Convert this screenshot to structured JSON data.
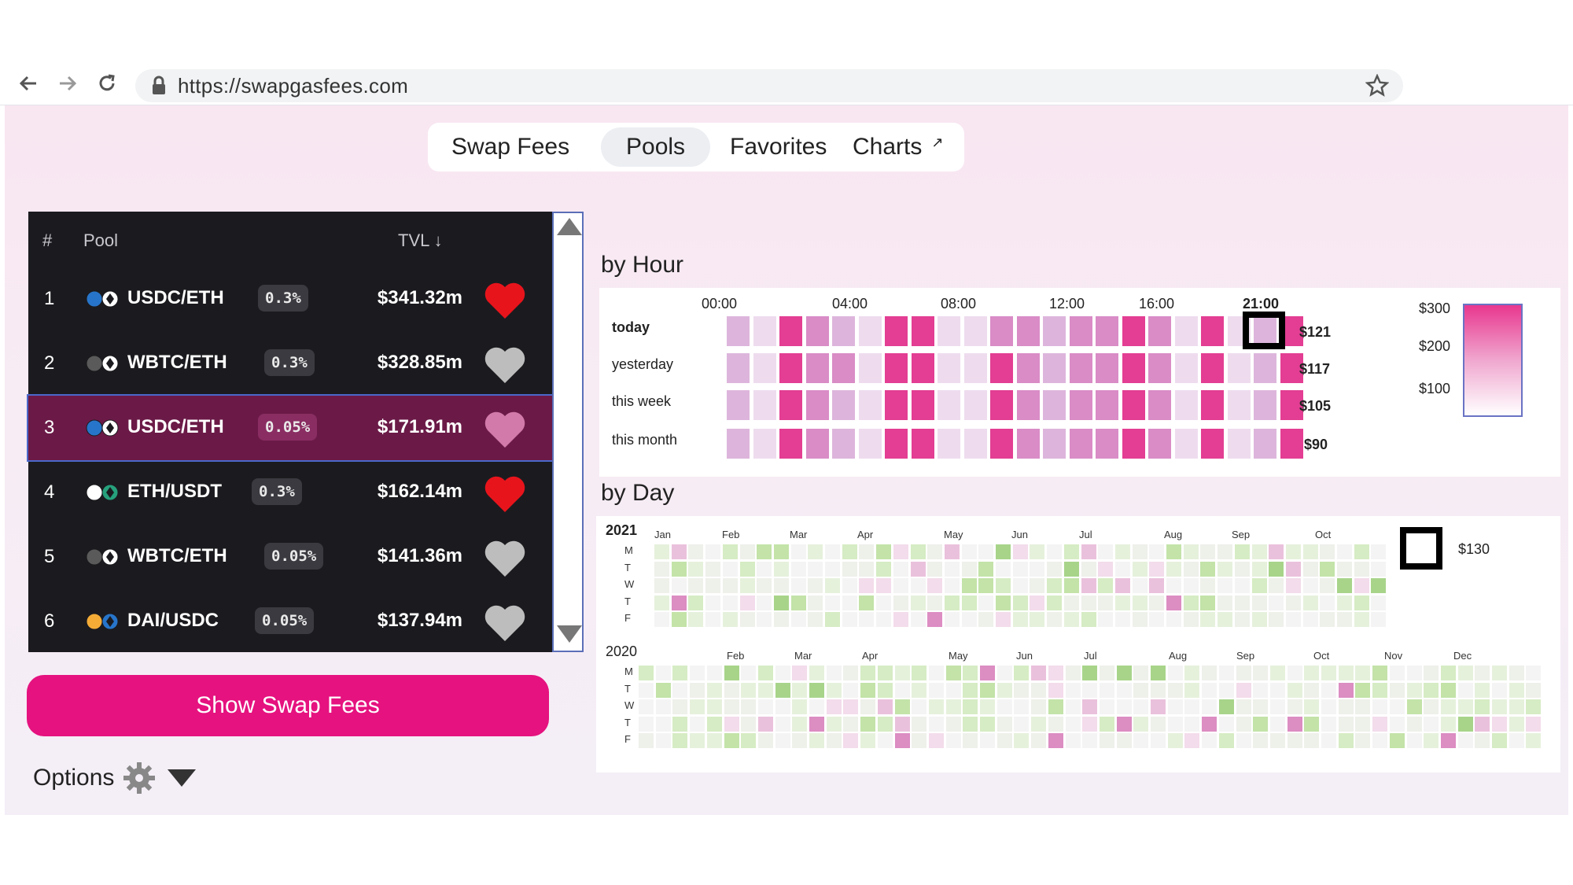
{
  "browser": {
    "url": "https://swapgasfees.com",
    "back_icon": "arrow-left-icon",
    "forward_icon": "arrow-right-icon",
    "reload_icon": "reload-icon",
    "star_icon": "star-icon"
  },
  "tabs": [
    {
      "label": "Swap Fees",
      "active": false
    },
    {
      "label": "Pools",
      "active": true
    },
    {
      "label": "Favorites",
      "active": false
    },
    {
      "label": "Charts",
      "active": false,
      "external_icon": "↗"
    }
  ],
  "pools": {
    "headers": {
      "rank": "#",
      "pool": "Pool",
      "tvl": "TVL ↓"
    },
    "rows": [
      {
        "rank": "1",
        "pair": "USDC/ETH",
        "fee": "0.3%",
        "tvl": "$341.32m",
        "favorite": true,
        "selected": false,
        "token_colors": [
          "#2775ca",
          "#ffffff"
        ]
      },
      {
        "rank": "2",
        "pair": "WBTC/ETH",
        "fee": "0.3%",
        "tvl": "$328.85m",
        "favorite": false,
        "selected": false,
        "token_colors": [
          "#5a5a5a",
          "#ffffff"
        ]
      },
      {
        "rank": "3",
        "pair": "USDC/ETH",
        "fee": "0.05%",
        "tvl": "$171.91m",
        "favorite": false,
        "selected": true,
        "token_colors": [
          "#2775ca",
          "#ffffff"
        ]
      },
      {
        "rank": "4",
        "pair": "ETH/USDT",
        "fee": "0.3%",
        "tvl": "$162.14m",
        "favorite": true,
        "selected": false,
        "token_colors": [
          "#ffffff",
          "#26a17b"
        ]
      },
      {
        "rank": "5",
        "pair": "WBTC/ETH",
        "fee": "0.05%",
        "tvl": "$141.36m",
        "favorite": false,
        "selected": false,
        "token_colors": [
          "#5a5a5a",
          "#ffffff"
        ]
      },
      {
        "rank": "6",
        "pair": "DAI/USDC",
        "fee": "0.05%",
        "tvl": "$137.94m",
        "favorite": false,
        "selected": false,
        "token_colors": [
          "#f5ac37",
          "#2775ca"
        ]
      }
    ]
  },
  "show_swap_fees_label": "Show Swap Fees",
  "options_label": "Options",
  "colors": {
    "accent": "#e5127f",
    "heart_favorite": "#e8141c",
    "heart_default": "#bdbdbd",
    "selected_row": "#6b1a47",
    "table_bg": "#1b1b1f"
  },
  "by_hour": {
    "title": "by Hour",
    "ticks": [
      "00:00",
      "04:00",
      "08:00",
      "12:00",
      "16:00",
      "21:00"
    ],
    "rows": [
      {
        "label": "today",
        "value": "$121",
        "levels": [
          2,
          1,
          4,
          3,
          2,
          1,
          4,
          4,
          1,
          1,
          3,
          3,
          2,
          3,
          3,
          4,
          3,
          1,
          4,
          1,
          2,
          4
        ]
      },
      {
        "label": "yesterday",
        "value": "$117",
        "levels": [
          2,
          1,
          4,
          3,
          3,
          1,
          4,
          4,
          1,
          1,
          4,
          3,
          2,
          3,
          3,
          4,
          3,
          1,
          4,
          1,
          2,
          4
        ]
      },
      {
        "label": "this week",
        "value": "$105",
        "levels": [
          2,
          1,
          4,
          3,
          2,
          1,
          4,
          4,
          1,
          1,
          4,
          3,
          2,
          3,
          3,
          4,
          3,
          1,
          4,
          1,
          2,
          4
        ]
      },
      {
        "label": "this month",
        "value": "$90",
        "levels": [
          2,
          1,
          4,
          3,
          2,
          1,
          4,
          4,
          1,
          1,
          4,
          3,
          2,
          3,
          3,
          4,
          3,
          1,
          4,
          1,
          2,
          4
        ]
      }
    ],
    "selected_hour": "21:00",
    "legend": [
      "$300",
      "$200",
      "$100"
    ]
  },
  "by_day": {
    "title": "by Day",
    "day_labels": [
      "M",
      "T",
      "W",
      "T",
      "F"
    ],
    "selected_value": "$130",
    "years": [
      {
        "year": "2021",
        "months": [
          "Jan",
          "Feb",
          "Mar",
          "Apr",
          "May",
          "Jun",
          "Jul",
          "Aug",
          "Sep",
          "Oct"
        ],
        "weeks": 43
      },
      {
        "year": "2020",
        "months": [
          "Feb",
          "Mar",
          "Apr",
          "May",
          "Jun",
          "Jul",
          "Aug",
          "Sep",
          "Oct",
          "Nov",
          "Dec"
        ],
        "weeks": 53
      }
    ]
  }
}
